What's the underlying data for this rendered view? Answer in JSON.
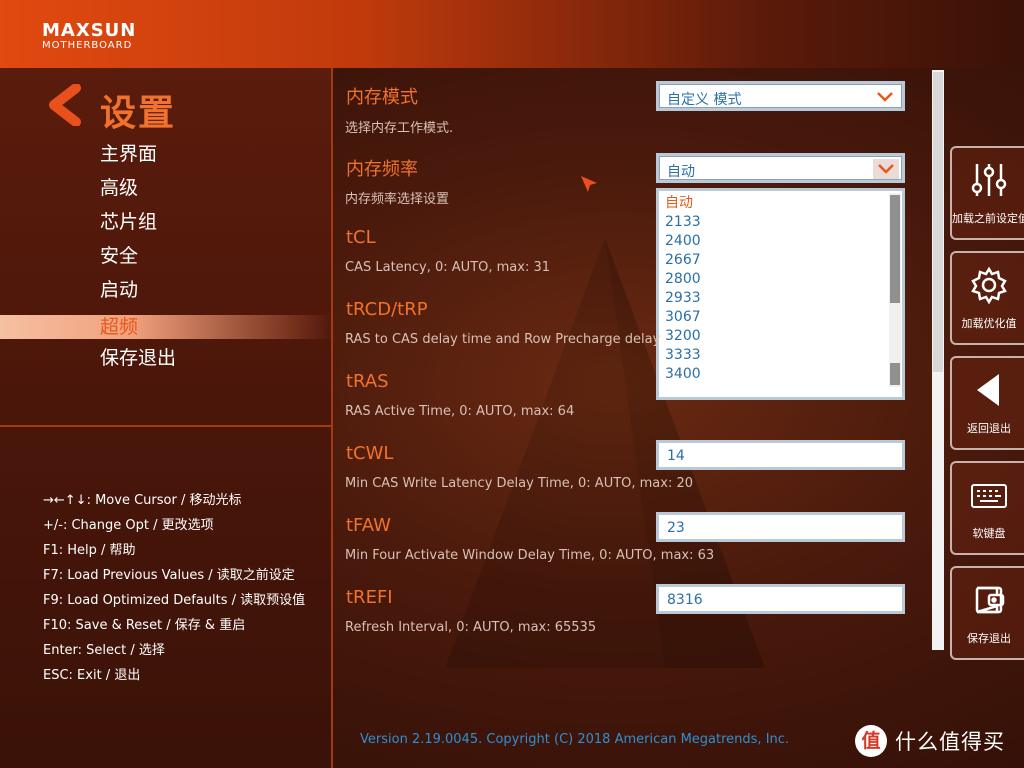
{
  "brand": {
    "name": "MAXSUN",
    "sub": "MOTHERBOARD"
  },
  "section_title": "设置",
  "menu": [
    {
      "label": "主界面"
    },
    {
      "label": "高级"
    },
    {
      "label": "芯片组"
    },
    {
      "label": "安全"
    },
    {
      "label": "启动"
    },
    {
      "label": "超频",
      "active": true
    },
    {
      "label": "保存退出"
    }
  ],
  "help": [
    "→←↑↓: Move Cursor  /  移动光标",
    "+/-: Change Opt  /  更改选项",
    "F1: Help  /  帮助",
    "F7: Load Previous Values  /  读取之前设定",
    "F9: Load Optimized Defaults  /  读取预设值",
    "F10: Save & Reset  /  保存 & 重启",
    "Enter: Select  /  选择",
    "ESC: Exit  /  退出"
  ],
  "settings": {
    "mem_mode": {
      "title": "内存模式",
      "desc": "选择内存工作模式.",
      "value": "自定义 模式"
    },
    "mem_freq": {
      "title": "内存频率",
      "desc": "内存频率选择设置",
      "value": "自动"
    },
    "tcl": {
      "title": "tCL",
      "desc": "CAS Latency, 0: AUTO, max: 31"
    },
    "trcd": {
      "title": "tRCD/tRP",
      "desc": "RAS to CAS delay time and Row Precharge delay"
    },
    "tras": {
      "title": "tRAS",
      "desc": "RAS Active Time, 0: AUTO, max: 64"
    },
    "tcwl": {
      "title": "tCWL",
      "desc": "Min CAS Write Latency Delay Time, 0: AUTO, max: 20",
      "value": "14"
    },
    "tfaw": {
      "title": "tFAW",
      "desc": "Min Four Activate Window Delay Time, 0: AUTO, max: 63",
      "value": "23"
    },
    "trefi": {
      "title": "tREFI",
      "desc": "Refresh Interval, 0: AUTO, max: 65535",
      "value": "8316"
    }
  },
  "freq_options": [
    "自动",
    "2133",
    "2400",
    "2667",
    "2800",
    "2933",
    "3067",
    "3200",
    "3333",
    "3400"
  ],
  "side_buttons": [
    {
      "label": "加载之前设定值",
      "icon": "sliders-icon"
    },
    {
      "label": "加载优化值",
      "icon": "gear-icon"
    },
    {
      "label": "返回退出",
      "icon": "back-triangle-icon"
    },
    {
      "label": "软键盘",
      "icon": "keyboard-icon"
    },
    {
      "label": "保存退出",
      "icon": "save-exit-icon"
    }
  ],
  "version": "Version 2.19.0045. Copyright (C) 2018 American Megatrends, Inc.",
  "watermark": {
    "badge": "值",
    "text": "什么值得买"
  },
  "colors": {
    "accent": "#f0722c",
    "link": "#2f8fd0",
    "value": "#2a6fa8"
  }
}
